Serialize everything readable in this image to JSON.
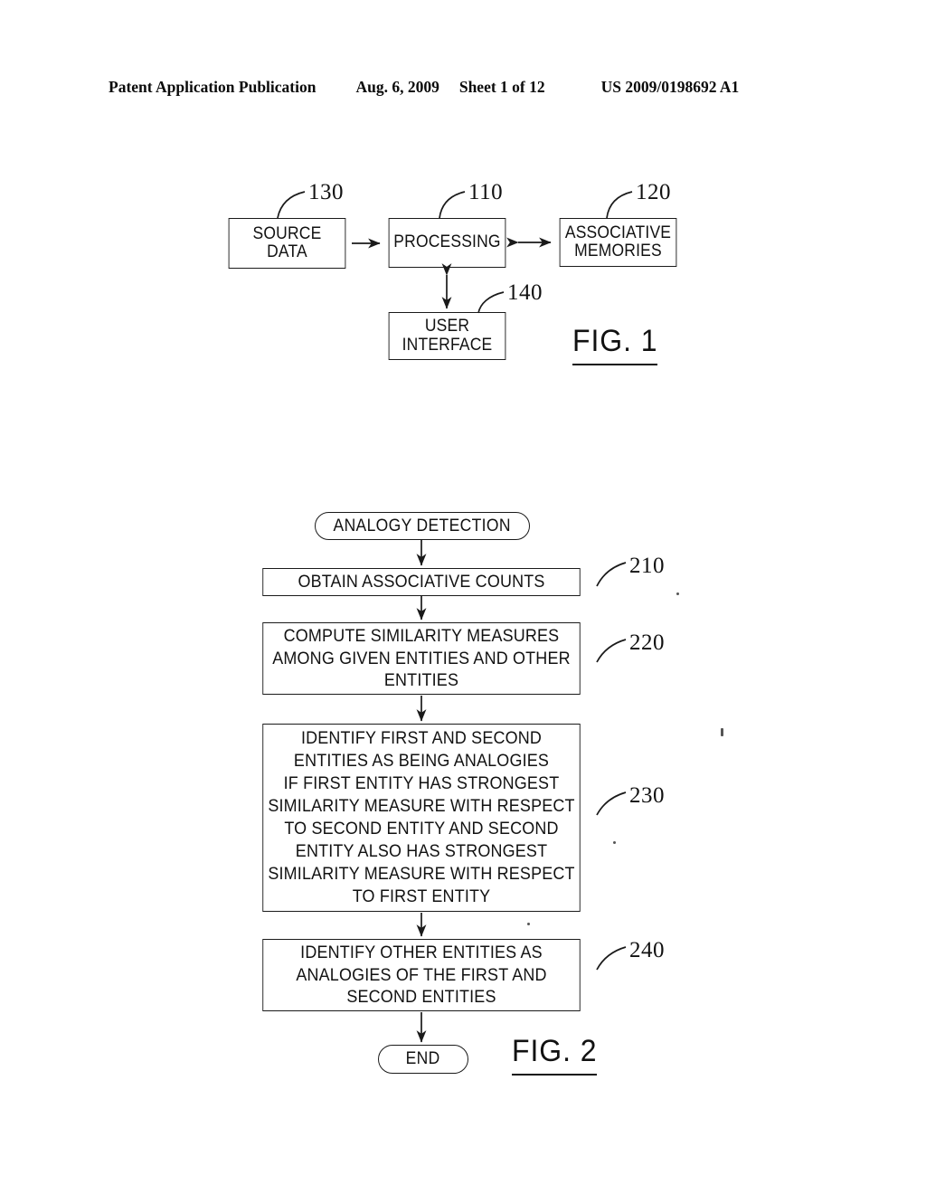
{
  "header": {
    "publication": "Patent Application Publication",
    "date": "Aug. 6, 2009",
    "sheet": "Sheet 1 of 12",
    "number": "US 2009/0198692 A1"
  },
  "figure1": {
    "caption": "FIG. 1",
    "blocks": [
      {
        "id": "source-data",
        "label": "SOURCE\nDATA",
        "ref": "130"
      },
      {
        "id": "processing",
        "label": "PROCESSING",
        "ref": "110"
      },
      {
        "id": "associative-memories",
        "label": "ASSOCIATIVE\nMEMORIES",
        "ref": "120"
      },
      {
        "id": "user-interface",
        "label": "USER\nINTERFACE",
        "ref": "140"
      }
    ]
  },
  "figure2": {
    "caption": "FIG. 2",
    "start_label": "ANALOGY DETECTION",
    "end_label": "END",
    "steps": [
      {
        "id": "step-210",
        "ref": "210",
        "label": "OBTAIN ASSOCIATIVE COUNTS"
      },
      {
        "id": "step-220",
        "ref": "220",
        "label": "COMPUTE SIMILARITY MEASURES\nAMONG GIVEN ENTITIES AND OTHER\nENTITIES"
      },
      {
        "id": "step-230",
        "ref": "230",
        "label": "IDENTIFY FIRST AND SECOND\nENTITIES AS BEING ANALOGIES\nIF FIRST ENTITY HAS STRONGEST\nSIMILARITY MEASURE WITH RESPECT\nTO SECOND ENTITY AND SECOND\nENTITY ALSO HAS STRONGEST\nSIMILARITY MEASURE WITH RESPECT\nTO FIRST ENTITY"
      },
      {
        "id": "step-240",
        "ref": "240",
        "label": "IDENTIFY OTHER ENTITIES AS\nANALOGIES OF THE FIRST AND\nSECOND ENTITIES"
      }
    ]
  },
  "colors": {
    "ink": "#111111",
    "paper": "#ffffff"
  }
}
